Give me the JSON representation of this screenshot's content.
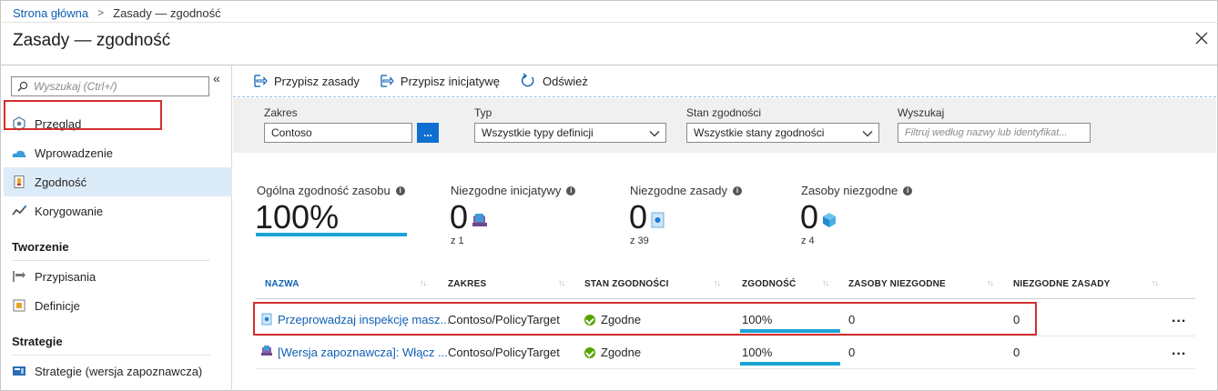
{
  "breadcrumb": {
    "home": "Strona główna",
    "separator": ">",
    "current": "Zasady — zgodność"
  },
  "page": {
    "title": "Zasady — zgodność"
  },
  "sidebar": {
    "search_placeholder": "Wyszukaj (Ctrl+/)",
    "collapse": "«",
    "items": [
      {
        "label": "Przegląd",
        "icon": "overview-icon"
      },
      {
        "label": "Wprowadzenie",
        "icon": "cloud-icon"
      },
      {
        "label": "Zgodność",
        "icon": "compliance-icon",
        "selected": true
      },
      {
        "label": "Korygowanie",
        "icon": "remediation-icon"
      }
    ],
    "sections": [
      {
        "title": "Tworzenie",
        "items": [
          {
            "label": "Przypisania",
            "icon": "assignments-icon"
          },
          {
            "label": "Definicje",
            "icon": "definitions-icon"
          }
        ]
      },
      {
        "title": "Strategie",
        "items": [
          {
            "label": "Strategie (wersja zapoznawcza)",
            "icon": "blueprints-icon"
          }
        ]
      }
    ]
  },
  "toolbar": {
    "assign_policy": "Przypisz zasady",
    "assign_initiative": "Przypisz inicjatywę",
    "refresh": "Odśwież"
  },
  "filters": {
    "scope": {
      "label": "Zakres",
      "value": "Contoso",
      "button": "..."
    },
    "type": {
      "label": "Typ",
      "value": "Wszystkie typy definicji"
    },
    "state": {
      "label": "Stan zgodności",
      "value": "Wszystkie stany zgodności"
    },
    "search": {
      "label": "Wyszukaj",
      "placeholder": "Filtruj według nazwy lub identyfikat..."
    }
  },
  "kpis": {
    "overall": {
      "label": "Ogólna zgodność zasobu",
      "value": "100%",
      "fraction": 1.0
    },
    "initiatives": {
      "label": "Niezgodne inicjatywy",
      "value": "0",
      "sub": "z 1"
    },
    "policies": {
      "label": "Niezgodne zasady",
      "value": "0",
      "sub": "z 39"
    },
    "resources": {
      "label": "Zasoby niezgodne",
      "value": "0",
      "sub": "z 4"
    }
  },
  "table": {
    "columns": [
      "NAZWA",
      "ZAKRES",
      "STAN ZGODNOŚCI",
      "ZGODNOŚĆ",
      "ZASOBY NIEZGODNE",
      "NIEZGODNE ZASADY"
    ],
    "rows": [
      {
        "name": "Przeprowadzaj inspekcję masz...",
        "scope": "Contoso/PolicyTarget",
        "state": "Zgodne",
        "compliance": "100%",
        "compliance_fraction": 1.0,
        "noncompliant_resources": "0",
        "noncompliant_policies": "0",
        "more": "...",
        "icon": "policy-icon"
      },
      {
        "name": "[Wersja zapoznawcza]: Włącz ...",
        "scope": "Contoso/PolicyTarget",
        "state": "Zgodne",
        "compliance": "100%",
        "compliance_fraction": 1.0,
        "noncompliant_resources": "0",
        "noncompliant_policies": "0",
        "more": "...",
        "icon": "initiative-icon"
      }
    ]
  },
  "colors": {
    "accent": "#1aa3d6",
    "link": "#0f5fb4",
    "highlight": "#d32f2f",
    "selected_bg": "#dcebf8",
    "ok": "#57a300"
  }
}
